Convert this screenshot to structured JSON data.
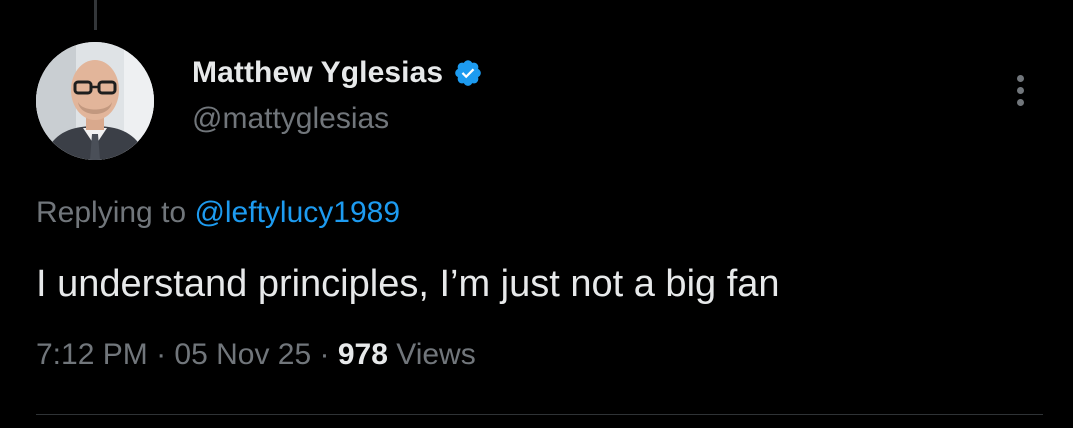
{
  "tweet": {
    "author": {
      "display_name": "Matthew Yglesias",
      "handle": "@mattyglesias",
      "verified": true
    },
    "replying_prefix": "Replying to ",
    "replying_to": "@leftylucy1989",
    "text": "I understand principles, I’m just not a big fan",
    "time": "7:12 PM",
    "separator": " · ",
    "date": "05 Nov 25",
    "views_count": "978",
    "views_label": " Views"
  },
  "icons": {
    "verified": "verified-badge-icon",
    "more": "more-options-icon"
  },
  "colors": {
    "background": "#000000",
    "primary_text": "#e7e9ea",
    "secondary_text": "#71767b",
    "link": "#1d9bf0",
    "verified_badge": "#1d9bf0",
    "divider": "#2f3336"
  }
}
